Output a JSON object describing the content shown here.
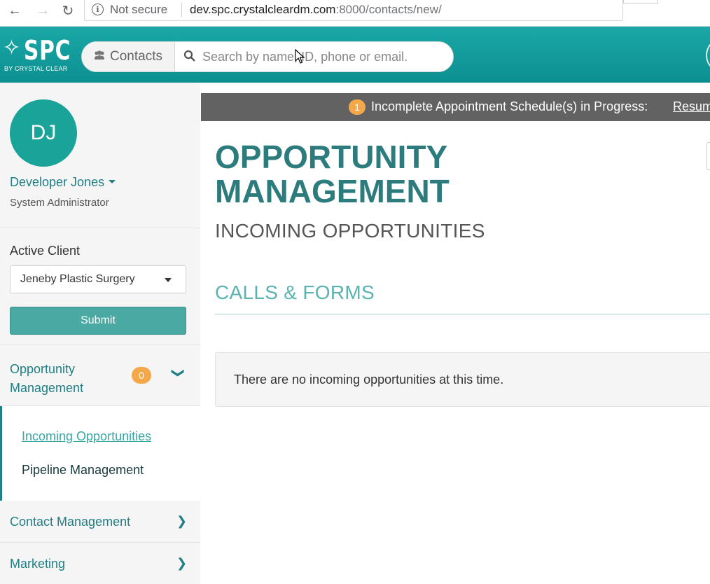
{
  "browser": {
    "back_icon": "←",
    "forward_icon": "→",
    "reload_icon": "↻",
    "security_label": "Not secure",
    "url_host": "dev.spc.crystalcleardm.com",
    "url_rest": ":8000/contacts/new/"
  },
  "header": {
    "logo_text": "SPC",
    "logo_subtext": "BY CRYSTAL CLEAR",
    "search_scope_label": "Contacts",
    "search_placeholder": "Search by name, ID, phone or email."
  },
  "sidebar": {
    "avatar_initials": "DJ",
    "user_name": "Developer Jones",
    "user_role": "System Administrator",
    "active_client_label": "Active Client",
    "active_client_value": "Jeneby Plastic Surgery",
    "submit_label": "Submit",
    "opportunity": {
      "label_line1": "Opportunity",
      "label_line2": "Management",
      "badge": "0",
      "subitems": [
        "Incoming Opportunities",
        "Pipeline Management"
      ]
    },
    "contact_management_label": "Contact Management",
    "marketing_label": "Marketing"
  },
  "main": {
    "alert_badge": "1",
    "alert_text": "Incomplete Appointment Schedule(s) in Progress:",
    "alert_link": "Resume",
    "title_line1": "OPPORTUNITY",
    "title_line2": "MANAGEMENT",
    "subtitle": "INCOMING OPPORTUNITIES",
    "section_title": "CALLS & FORMS",
    "empty_message": "There are no incoming opportunities at this time."
  },
  "colors": {
    "header_teal": "#1aa8a7",
    "brand_dark_teal": "#2c7b7d",
    "accent_teal": "#3aa7a5",
    "badge_orange": "#f5a84a",
    "alert_gray": "#626262",
    "submit_green": "#4aaaa3"
  }
}
